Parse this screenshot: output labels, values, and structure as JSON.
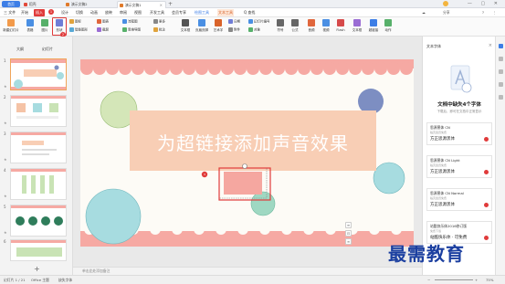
{
  "titlebar": {
    "home": "首页",
    "tabs": [
      {
        "label": "稻壳",
        "color": "#e24a3b"
      },
      {
        "label": "演示文稿2",
        "color": "#e07a2b"
      },
      {
        "label": "演示文稿1",
        "color": "#e07a2b"
      }
    ],
    "plus": "+",
    "window_controls": "— ▢ ✕"
  },
  "menubar": {
    "file": "三 文件",
    "items": [
      "开始",
      "插入",
      "设计",
      "切换",
      "动画",
      "放映",
      "审阅",
      "视图",
      "开发工具",
      "会员专享",
      "绘图工具",
      "文本工具"
    ],
    "active": "插入",
    "search": "Q 查找",
    "right": [
      "分享",
      "?",
      "⋮"
    ],
    "badge1": "1"
  },
  "ribbon": {
    "new_slide": "新建幻灯片",
    "table": "表格",
    "picture": "图片",
    "shapes": "形状",
    "icons": "图标",
    "smartart": "智能图形",
    "chart": "图表",
    "screenshot": "截屏",
    "flowchart": "流程图",
    "mindmap": "思维导图",
    "more": "更多",
    "comment": "批注",
    "textbox": "文本框",
    "header_footer": "页眉页脚",
    "art_text": "艺术字",
    "date": "日期",
    "attachment": "附件",
    "slide_number": "幻灯片编号",
    "object": "对象",
    "symbol": "符号",
    "formula": "公式",
    "audio": "音频",
    "video": "视频",
    "flash": "Flash",
    "text_frame": "文本框",
    "hyperlink": "超链接",
    "action": "动作",
    "badge2": "2"
  },
  "leftpanel": {
    "tabs": [
      "大纲",
      "幻灯片"
    ],
    "slides": [
      "1",
      "2",
      "3",
      "4",
      "5",
      "6"
    ],
    "add": "+"
  },
  "slide": {
    "title": "为超链接添加声音效果",
    "marker": "3"
  },
  "notes": {
    "placeholder": "单击此处添加备注"
  },
  "rightpanel": {
    "header": "文本字体",
    "title": "文档中缺失4个字体",
    "subtitle": "下载后，即可在文档中正常显示",
    "fonts": [
      {
        "name": "思源黑体 CN",
        "desc": "稻壳会员免费",
        "sample": "方正思源黑体"
      },
      {
        "name": "思源黑体 CN Light",
        "desc": "稻壳会员免费",
        "sample": "方正思源黑体"
      },
      {
        "name": "思源黑体 CN Normal",
        "desc": "稻壳会员免费",
        "sample": "方正思源黑体"
      },
      {
        "name": "站酷快乐体2016修订版",
        "desc": "免费下载",
        "sample": "站酷快乐体 · 可免费"
      }
    ]
  },
  "statusbar": {
    "slide_count": "幻灯片 1 / 21",
    "theme": "Office 主题",
    "missing_font": "缺失字体",
    "zoom": "75%"
  },
  "watermark": "最需教育",
  "colors": {
    "accent_red": "#e03b3b",
    "wps_blue": "#3d7ee6",
    "slide_title_bg": "#f8ceb5",
    "scallop": "#f6a9a3"
  }
}
